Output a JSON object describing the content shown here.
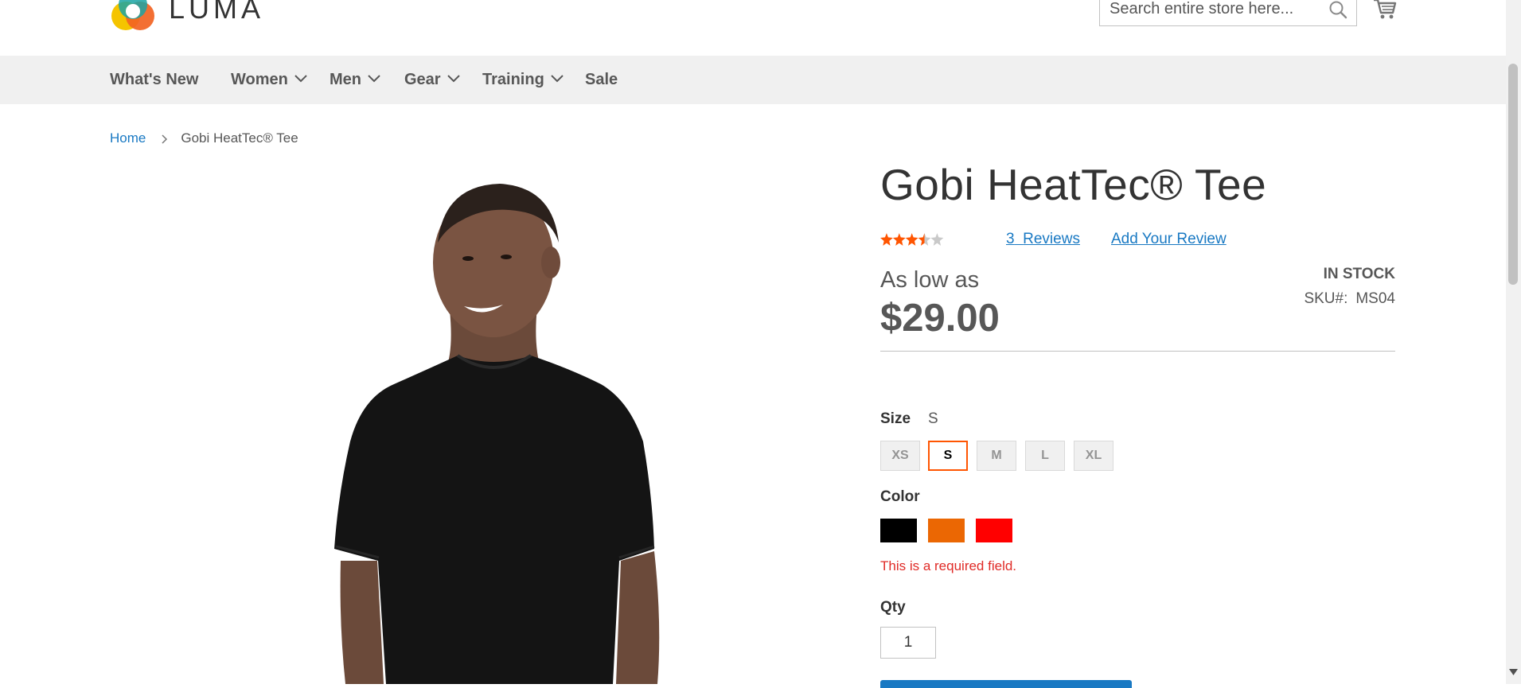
{
  "header": {
    "logo_text": "LUMA",
    "search_placeholder": "Search entire store here...",
    "search_icon": "search-icon",
    "cart_icon": "cart-icon"
  },
  "nav": {
    "items": [
      {
        "label": "What's New",
        "has_dropdown": false
      },
      {
        "label": "Women",
        "has_dropdown": true
      },
      {
        "label": "Men",
        "has_dropdown": true
      },
      {
        "label": "Gear",
        "has_dropdown": true
      },
      {
        "label": "Training",
        "has_dropdown": true
      },
      {
        "label": "Sale",
        "has_dropdown": false
      }
    ]
  },
  "breadcrumb": {
    "home": "Home",
    "current": "Gobi HeatTec® Tee"
  },
  "product": {
    "title": "Gobi HeatTec® Tee",
    "rating_stars": 3.5,
    "rating_max": 5,
    "reviews_count": "3",
    "reviews_label": "Reviews",
    "add_review": "Add Your Review",
    "price_prefix": "As low as",
    "price": "$29.00",
    "stock": "In stock",
    "sku_label": "SKU#:",
    "sku": "MS04"
  },
  "options": {
    "size_label": "Size",
    "size_selected": "S",
    "sizes": [
      "XS",
      "S",
      "M",
      "L",
      "XL"
    ],
    "color_label": "Color",
    "colors": [
      {
        "name": "Black",
        "hex": "#000000"
      },
      {
        "name": "Orange",
        "hex": "#eb6703"
      },
      {
        "name": "Red",
        "hex": "#ff0000"
      }
    ],
    "color_error": "This is a required field.",
    "qty_label": "Qty",
    "qty_value": "1"
  },
  "theme": {
    "accent": "#1979c3",
    "selected_border": "#ff5501",
    "error": "#e02b27",
    "star": "#ff5501"
  }
}
